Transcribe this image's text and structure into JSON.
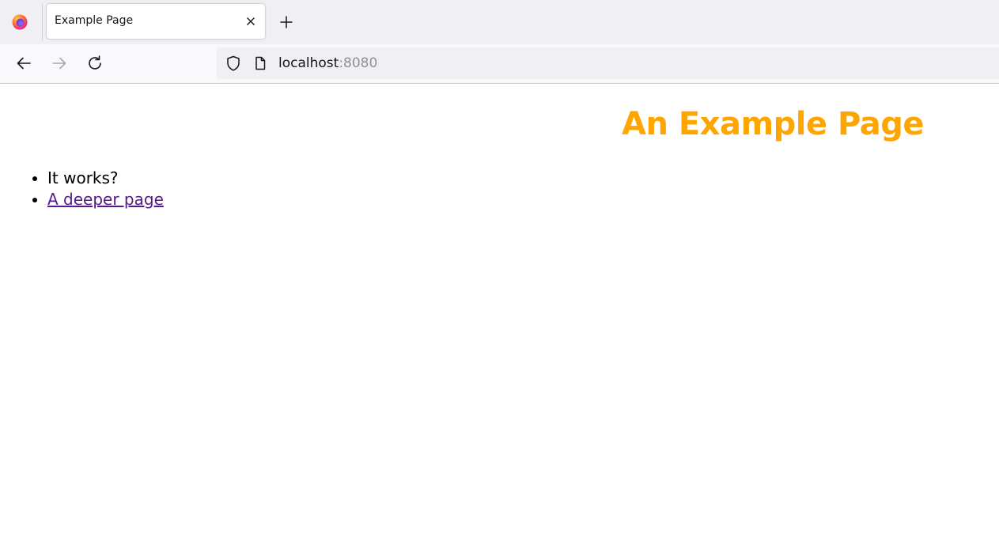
{
  "browser": {
    "tab": {
      "title": "Example Page"
    },
    "address_bar": {
      "host": "localhost",
      "port": ":8080"
    },
    "icons": {
      "app": "firefox-icon",
      "close_tab": "close-icon",
      "new_tab": "plus-icon",
      "back": "back-arrow-icon",
      "forward": "forward-arrow-icon",
      "reload": "reload-icon",
      "tracking_protection": "shield-icon",
      "page_info": "page-icon"
    }
  },
  "page": {
    "heading": "An Example Page",
    "heading_color": "#ffa500",
    "items": [
      {
        "text": "It works?"
      },
      {
        "text": "A deeper page",
        "is_link": true
      }
    ],
    "link_color": "#551a8b"
  }
}
